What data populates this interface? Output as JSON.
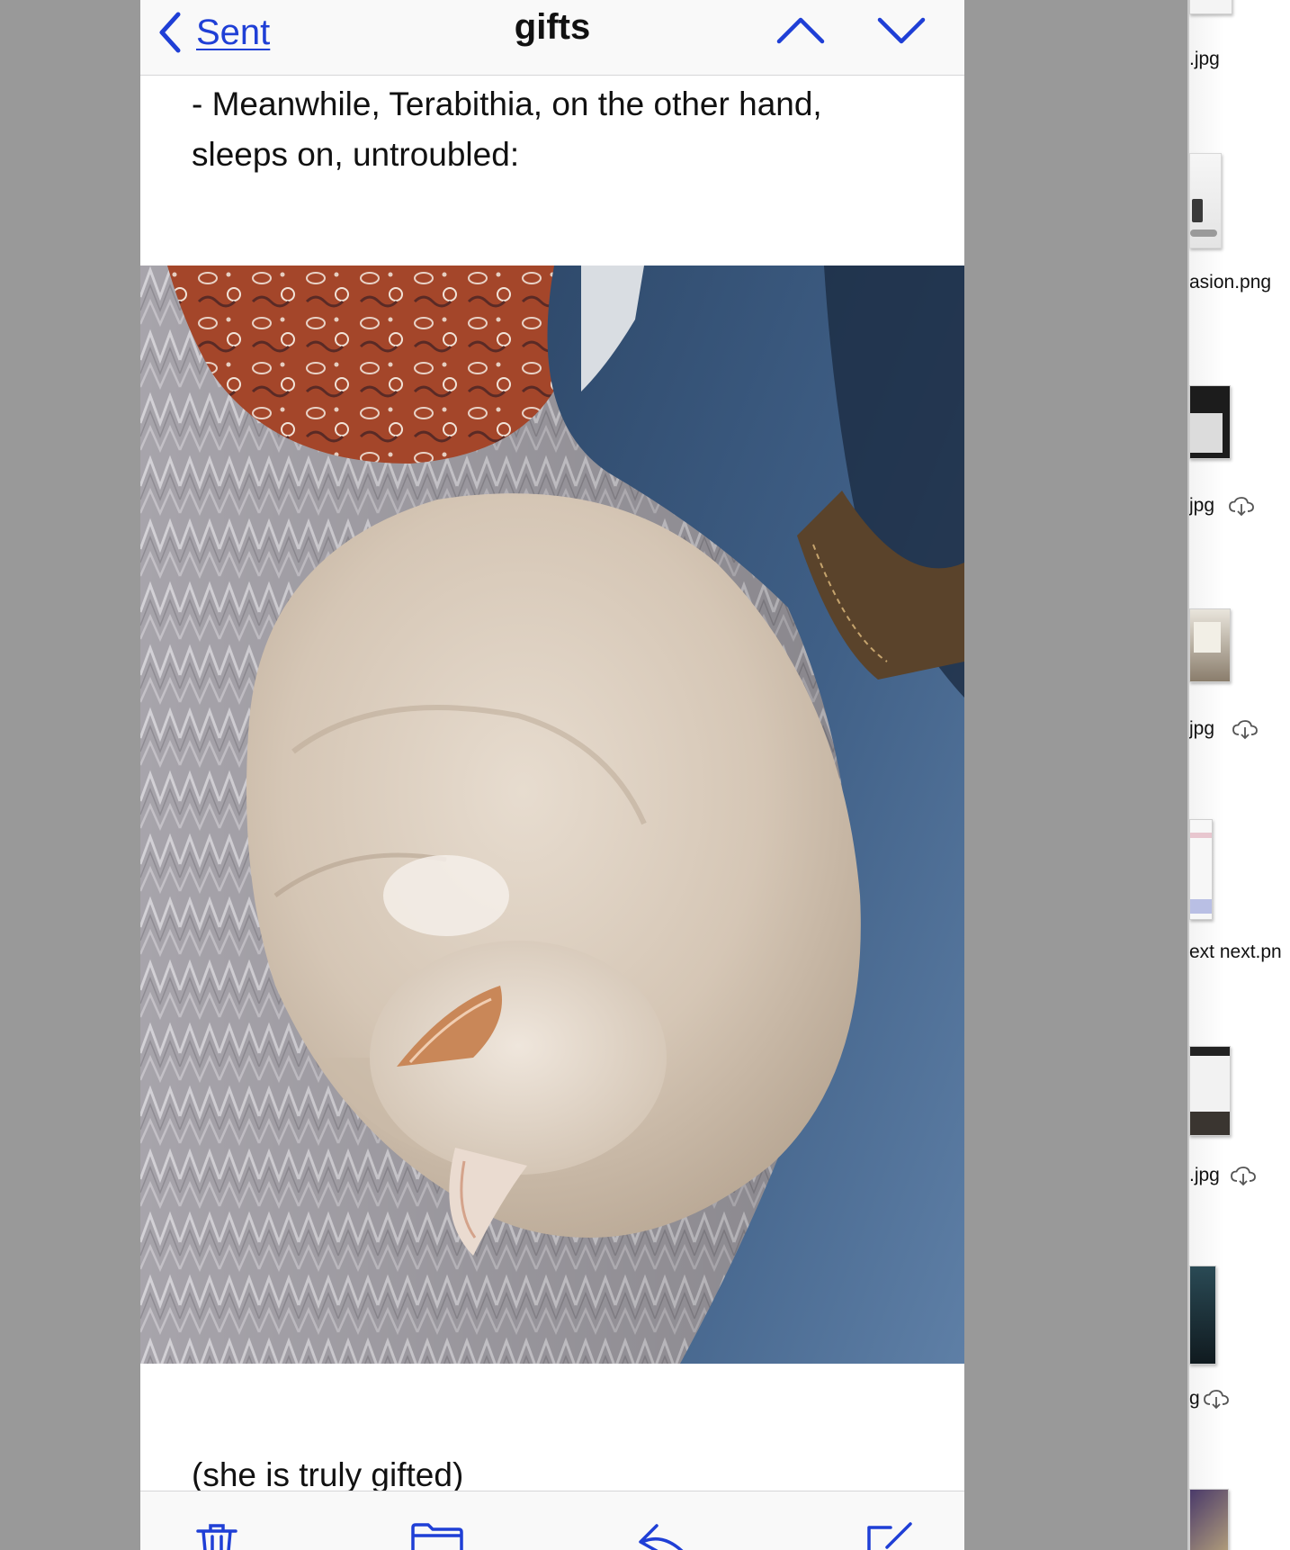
{
  "nav": {
    "back_label": "Sent",
    "title": "gifts"
  },
  "message": {
    "body_text": "- Meanwhile, Terabithia, on the other hand, sleeps on, untroubled:",
    "caption": "(she is truly gifted)"
  },
  "finder": {
    "files": [
      {
        "name": ".jpg",
        "cloud": false
      },
      {
        "name": "asion.png",
        "cloud": false
      },
      {
        "name": "jpg",
        "cloud": true
      },
      {
        "name": "jpg",
        "cloud": true
      },
      {
        "name": "ext next.pn",
        "cloud": false
      },
      {
        "name": ".jpg",
        "cloud": true
      },
      {
        "name": "g",
        "cloud": true
      }
    ]
  },
  "colors": {
    "accent": "#1f3fd6",
    "desktop": "#999999",
    "toolbar_bg": "#f9f9f9"
  }
}
